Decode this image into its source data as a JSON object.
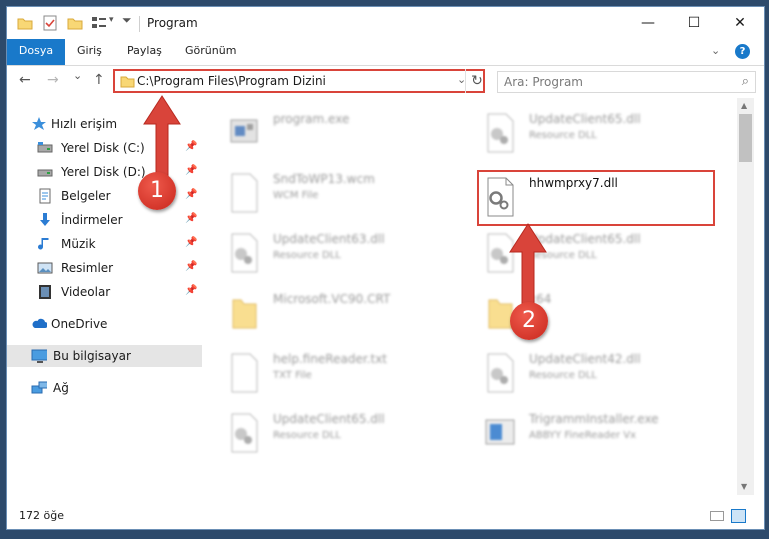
{
  "window": {
    "title": "Program",
    "caption": {
      "minimize": "—",
      "maximize": "☐",
      "close": "✕"
    }
  },
  "ribbon": {
    "tabs": [
      "Dosya",
      "Giriş",
      "Paylaş",
      "Görünüm"
    ],
    "help": "?"
  },
  "navbar": {
    "back": "←",
    "forward": "→",
    "recent": "⌄",
    "up": "↑",
    "address": "C:\\Program Files\\Program Dizini",
    "refresh": "↻",
    "search_placeholder": "Ara: Program"
  },
  "sidebar": {
    "items": [
      {
        "label": "Hızlı erişim",
        "icon": "star-icon",
        "pinned": false
      },
      {
        "label": "Yerel Disk (C:)",
        "icon": "drive-icon",
        "pinned": true
      },
      {
        "label": "Yerel Disk (D:)",
        "icon": "drive-icon",
        "pinned": true
      },
      {
        "label": "Belgeler",
        "icon": "documents-icon",
        "pinned": true
      },
      {
        "label": "İndirmeler",
        "icon": "download-icon",
        "pinned": true
      },
      {
        "label": "Müzik",
        "icon": "music-icon",
        "pinned": true
      },
      {
        "label": "Resimler",
        "icon": "pictures-icon",
        "pinned": true
      },
      {
        "label": "Videolar",
        "icon": "videos-icon",
        "pinned": true
      },
      {
        "label": "OneDrive",
        "icon": "cloud-icon",
        "pinned": false
      },
      {
        "label": "Bu bilgisayar",
        "icon": "computer-icon",
        "pinned": false,
        "selected": true
      },
      {
        "label": "Ağ",
        "icon": "network-icon",
        "pinned": false
      }
    ]
  },
  "files": {
    "left": [
      {
        "name": "program.exe",
        "desc": "",
        "icon": "exe-icon"
      },
      {
        "name": "SndToWP13.wcm",
        "desc": "WCM File",
        "icon": "file-icon"
      },
      {
        "name": "UpdateClient63.dll",
        "desc": "Resource DLL",
        "icon": "dll-icon"
      },
      {
        "name": "Microsoft.VC90.CRT",
        "desc": "",
        "icon": "folder-icon"
      },
      {
        "name": "help.fineReader.txt",
        "desc": "TXT File",
        "icon": "file-icon"
      },
      {
        "name": "UpdateClient65.dll",
        "desc": "Resource DLL",
        "icon": "dll-icon"
      }
    ],
    "right": [
      {
        "name": "UpdateClient65.dll",
        "desc": "Resource DLL",
        "icon": "dll-icon"
      },
      {
        "name": "hhwmprxy7.dll",
        "desc": "",
        "icon": "dll-icon",
        "highlight": true
      },
      {
        "name": "UpdateClient65.dll",
        "desc": "Resource DLL",
        "icon": "dll-icon"
      },
      {
        "name": "x64",
        "desc": "",
        "icon": "folder-icon"
      },
      {
        "name": "UpdateClient42.dll",
        "desc": "Resource DLL",
        "icon": "dll-icon"
      },
      {
        "name": "TrigrammInstaller.exe",
        "desc": "ABBYY FineReader Vx",
        "icon": "installer-icon"
      }
    ]
  },
  "annotations": {
    "step1": "1",
    "step2": "2"
  },
  "status": {
    "count": "172 öğe"
  },
  "colors": {
    "accent": "#1979ca",
    "highlight": "#d9443a",
    "selected": "#e5e5e5"
  }
}
